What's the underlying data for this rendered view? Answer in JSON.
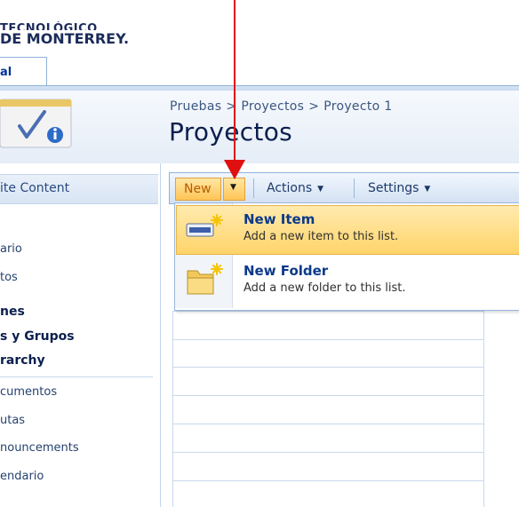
{
  "brand": {
    "line1": "TECNOLÓGICO",
    "line2": "DE MONTERREY."
  },
  "top_tab": {
    "label": "al"
  },
  "breadcrumb": {
    "items": [
      "Pruebas",
      "Proyectos",
      "Proyecto 1"
    ],
    "separator": ">"
  },
  "page_title": "Proyectos",
  "sidebar": {
    "header": "ite Content",
    "items": [
      {
        "label": "ario",
        "bold": false
      },
      {
        "label": "tos",
        "bold": false
      },
      {
        "label": "nes",
        "bold": true
      },
      {
        "label": "s y Grupos",
        "bold": true
      },
      {
        "label": "rarchy",
        "bold": true
      },
      {
        "label": "cumentos",
        "bold": false
      },
      {
        "label": "utas",
        "bold": false
      },
      {
        "label": "nouncements",
        "bold": false
      },
      {
        "label": "endario",
        "bold": false
      }
    ]
  },
  "toolbar": {
    "new_label": "New",
    "actions_label": "Actions",
    "settings_label": "Settings",
    "dropdown_glyph": "▼"
  },
  "menu": {
    "items": [
      {
        "title": "New Item",
        "description": "Add a new item to this list.",
        "icon": "new-item-icon",
        "highlighted": true
      },
      {
        "title": "New Folder",
        "description": "Add a new folder to this list.",
        "icon": "new-folder-icon",
        "highlighted": false
      }
    ]
  },
  "colors": {
    "annotation_arrow": "#e01010",
    "highlight": "#ffd46a",
    "accent_blue": "#0b3a8a"
  }
}
